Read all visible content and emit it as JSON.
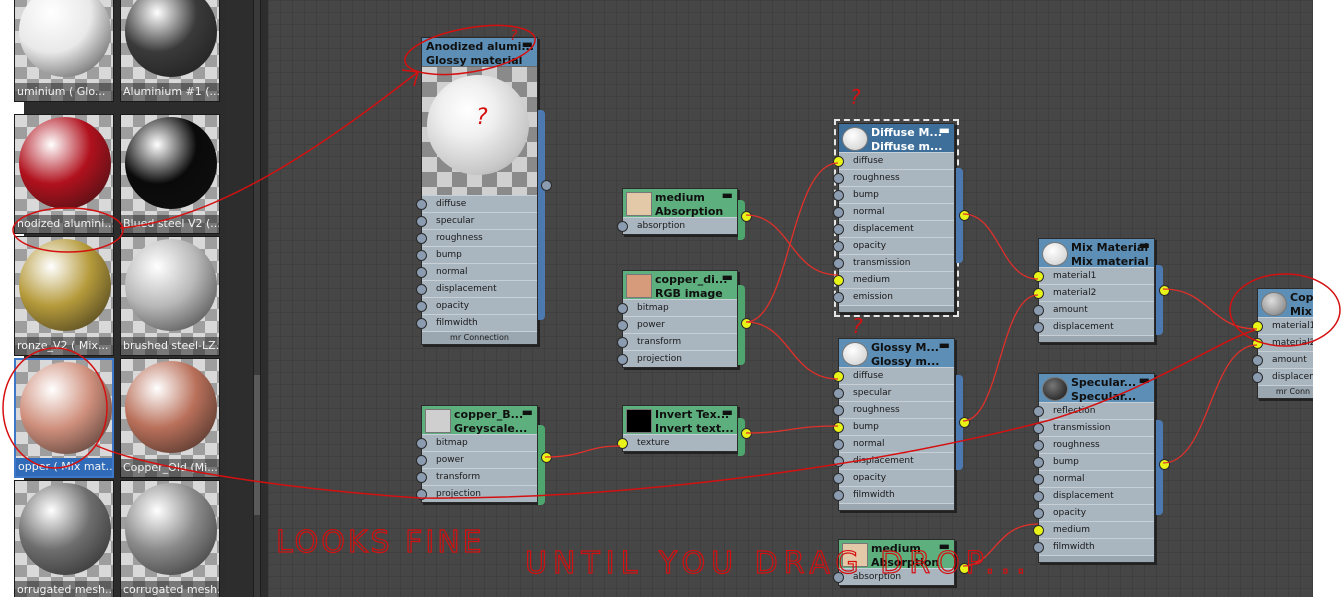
{
  "browser": {
    "materials": [
      {
        "caption": "uminium   ( Glo...",
        "color": "#e9e9e9"
      },
      {
        "caption": "Aluminium #1  (...",
        "color": "#3a3a3a"
      },
      {
        "caption": "nodized alumini...",
        "color": "#b0111d"
      },
      {
        "caption": "Blued steel V2  (...",
        "color": "#0a0a0a"
      },
      {
        "caption": "ronze_V2  ( Mix...",
        "color": "#b59a3b"
      },
      {
        "caption": "brushed steel-LZ...",
        "color": "#b8b8b8"
      },
      {
        "caption": "opper  ( Mix mat...",
        "color": "#cf8f7c"
      },
      {
        "caption": "Copper_Old  (Mi...",
        "color": "#b9705a"
      },
      {
        "caption": "orrugated mesh...",
        "color": "#6e6e6e"
      },
      {
        "caption": "corrugated mesh...",
        "color": "#8a8a8a"
      }
    ]
  },
  "nodes": {
    "anodized": {
      "title1": "Anodized  alumi...",
      "title2": "Glossy material",
      "slots": [
        "diffuse",
        "specular",
        "roughness",
        "bump",
        "normal",
        "displacement",
        "opacity",
        "filmwidth"
      ],
      "footer": "mr Connection"
    },
    "medium_top": {
      "title1": "medium",
      "title2": "Absorption",
      "slots": [
        "absorption"
      ]
    },
    "copper_diff": {
      "title1": "copper_di...",
      "title2": "RGB image",
      "slots": [
        "bitmap",
        "power",
        "transform",
        "projection"
      ]
    },
    "copper_bump": {
      "title1": "copper_B...",
      "title2": "Greyscale...",
      "slots": [
        "bitmap",
        "power",
        "transform",
        "projection"
      ]
    },
    "invert": {
      "title1": "Invert Tex...",
      "title2": "Invert text...",
      "slots": [
        "texture"
      ]
    },
    "diffuse_mat": {
      "title1": "Diffuse M...",
      "title2": "Diffuse m...",
      "slots": [
        "diffuse",
        "roughness",
        "bump",
        "normal",
        "displacement",
        "opacity",
        "transmission",
        "medium",
        "emission"
      ]
    },
    "glossy_mat": {
      "title1": "Glossy M...",
      "title2": "Glossy m...",
      "slots": [
        "diffuse",
        "specular",
        "roughness",
        "bump",
        "normal",
        "displacement",
        "opacity",
        "filmwidth"
      ]
    },
    "mix_mat": {
      "title1": "Mix Material",
      "title2": "Mix material",
      "slots": [
        "material1",
        "material2",
        "amount",
        "displacement"
      ]
    },
    "specular_mat": {
      "title1": "Specular...",
      "title2": "Specular...",
      "slots": [
        "reflection",
        "transmission",
        "roughness",
        "bump",
        "normal",
        "displacement",
        "opacity",
        "medium",
        "filmwidth"
      ]
    },
    "medium_bottom": {
      "title1": "medium",
      "title2": "Absorption",
      "slots": [
        "absorption"
      ]
    },
    "copper_mix": {
      "title1": "Copp",
      "title2": "Mix r",
      "slots": [
        "material1",
        "material2",
        "amount",
        "displacemen"
      ],
      "footer": "mr Conn"
    }
  },
  "annotations": {
    "q1": "?",
    "q2": "?",
    "q3": "?",
    "q4": "?",
    "note1": "LOOKS FINE",
    "note2": "UNTIL YOU DRAG DROP..."
  },
  "colors": {
    "annotation": "#d51010",
    "wire": "#e0302a",
    "port_active": "#e8f317"
  }
}
